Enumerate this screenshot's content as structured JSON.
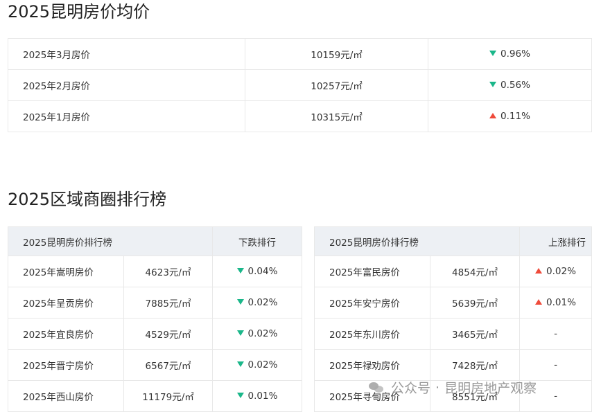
{
  "avg": {
    "title": "2025昆明房价均价",
    "rows": [
      {
        "label": "2025年3月房价",
        "price": "10159元/㎡",
        "dir": "down",
        "change": "0.96%"
      },
      {
        "label": "2025年2月房价",
        "price": "10257元/㎡",
        "dir": "down",
        "change": "0.56%"
      },
      {
        "label": "2025年1月房价",
        "price": "10315元/㎡",
        "dir": "up",
        "change": "0.11%"
      }
    ]
  },
  "districts": {
    "title": "2025区域商圈排行榜",
    "down_table": {
      "header_left": "2025昆明房价排行榜",
      "header_right": "下跌排行",
      "rows": [
        {
          "label": "2025年嵩明房价",
          "price": "4623元/㎡",
          "dir": "down",
          "change": "0.04%"
        },
        {
          "label": "2025年呈贡房价",
          "price": "7885元/㎡",
          "dir": "down",
          "change": "0.02%"
        },
        {
          "label": "2025年宜良房价",
          "price": "4529元/㎡",
          "dir": "down",
          "change": "0.02%"
        },
        {
          "label": "2025年晋宁房价",
          "price": "6567元/㎡",
          "dir": "down",
          "change": "0.02%"
        },
        {
          "label": "2025年西山房价",
          "price": "11179元/㎡",
          "dir": "down",
          "change": "0.01%"
        }
      ]
    },
    "up_table": {
      "header_left": "2025昆明房价排行榜",
      "header_right": "上涨排行",
      "rows": [
        {
          "label": "2025年富民房价",
          "price": "4854元/㎡",
          "dir": "up",
          "change": "0.02%"
        },
        {
          "label": "2025年安宁房价",
          "price": "5639元/㎡",
          "dir": "up",
          "change": "0.01%"
        },
        {
          "label": "2025年东川房价",
          "price": "3465元/㎡",
          "dir": "none",
          "change": "-"
        },
        {
          "label": "2025年禄劝房价",
          "price": "7428元/㎡",
          "dir": "none",
          "change": "-"
        },
        {
          "label": "2025年寻甸房价",
          "price": "8551元/㎡",
          "dir": "none",
          "change": "-"
        }
      ]
    }
  },
  "watermark": {
    "icon": "wechat-icon",
    "platform": "公众号",
    "separator": "·",
    "account": "昆明房地产观察"
  },
  "colors": {
    "up": "#ef4a3a",
    "down": "#1bb78a",
    "header_bg": "#edf0f4"
  }
}
